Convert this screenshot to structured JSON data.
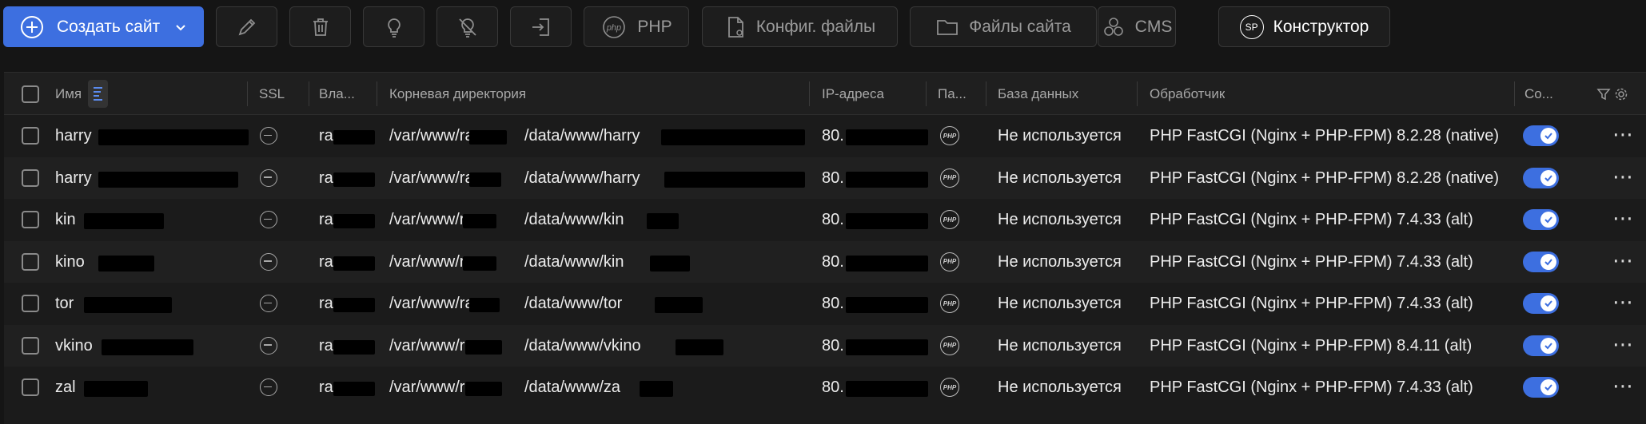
{
  "toolbar": {
    "create_label": "Создать сайт",
    "php_label": "PHP",
    "config_label": "Конфиг. файлы",
    "files_label": "Файлы сайта",
    "cms_label": "CMS",
    "builder_label": "Конструктор",
    "builder_badge": "SP",
    "php_icon_text": "php"
  },
  "table": {
    "headers": {
      "name": "Имя",
      "ssl": "SSL",
      "owner": "Вла...",
      "root": "Корневая директория",
      "ip": "IP-адреса",
      "pa": "Па...",
      "db": "База данных",
      "handler": "Обработчик",
      "status": "Со..."
    },
    "php_badge_text": "PHP",
    "rows": [
      {
        "name": "harry",
        "owner": "ra",
        "root_a": "/var/www/ra",
        "root_b": "/data/www/harry",
        "ip": "80.",
        "db": "Не используется",
        "handler": "PHP FastCGI (Nginx + PHP-FPM) 8.2.28 (native)"
      },
      {
        "name": "harry",
        "owner": "ra",
        "root_a": "/var/www/ra",
        "root_b": "/data/www/harry",
        "ip": "80.",
        "db": "Не используется",
        "handler": "PHP FastCGI (Nginx + PHP-FPM) 8.2.28 (native)"
      },
      {
        "name": "kin",
        "owner": "ra",
        "root_a": "/var/www/ra",
        "root_b": "/data/www/kin",
        "ip": "80.",
        "db": "Не используется",
        "handler": "PHP FastCGI (Nginx + PHP-FPM) 7.4.33 (alt)"
      },
      {
        "name": "kino",
        "owner": "ra",
        "root_a": "/var/www/ra",
        "root_b": "/data/www/kin",
        "ip": "80.",
        "db": "Не используется",
        "handler": "PHP FastCGI (Nginx + PHP-FPM) 7.4.33 (alt)"
      },
      {
        "name": "tor",
        "owner": "ra",
        "root_a": "/var/www/ra",
        "root_b": "/data/www/tor",
        "ip": "80.",
        "db": "Не используется",
        "handler": "PHP FastCGI (Nginx + PHP-FPM) 7.4.33 (alt)"
      },
      {
        "name": "vkino",
        "owner": "ra",
        "root_a": "/var/www/ra",
        "root_b": "/data/www/vkino",
        "ip": "80.",
        "db": "Не используется",
        "handler": "PHP FastCGI (Nginx + PHP-FPM) 8.4.11 (alt)"
      },
      {
        "name": "zal",
        "owner": "ra",
        "root_a": "/var/www/ra",
        "root_b": "/data/www/za",
        "ip": "80.",
        "db": "Не используется",
        "handler": "PHP FastCGI (Nginx + PHP-FPM) 7.4.33 (alt)"
      }
    ]
  },
  "colors": {
    "accent": "#3d6fe0",
    "background": "#151515",
    "row_alt": "#202020"
  }
}
